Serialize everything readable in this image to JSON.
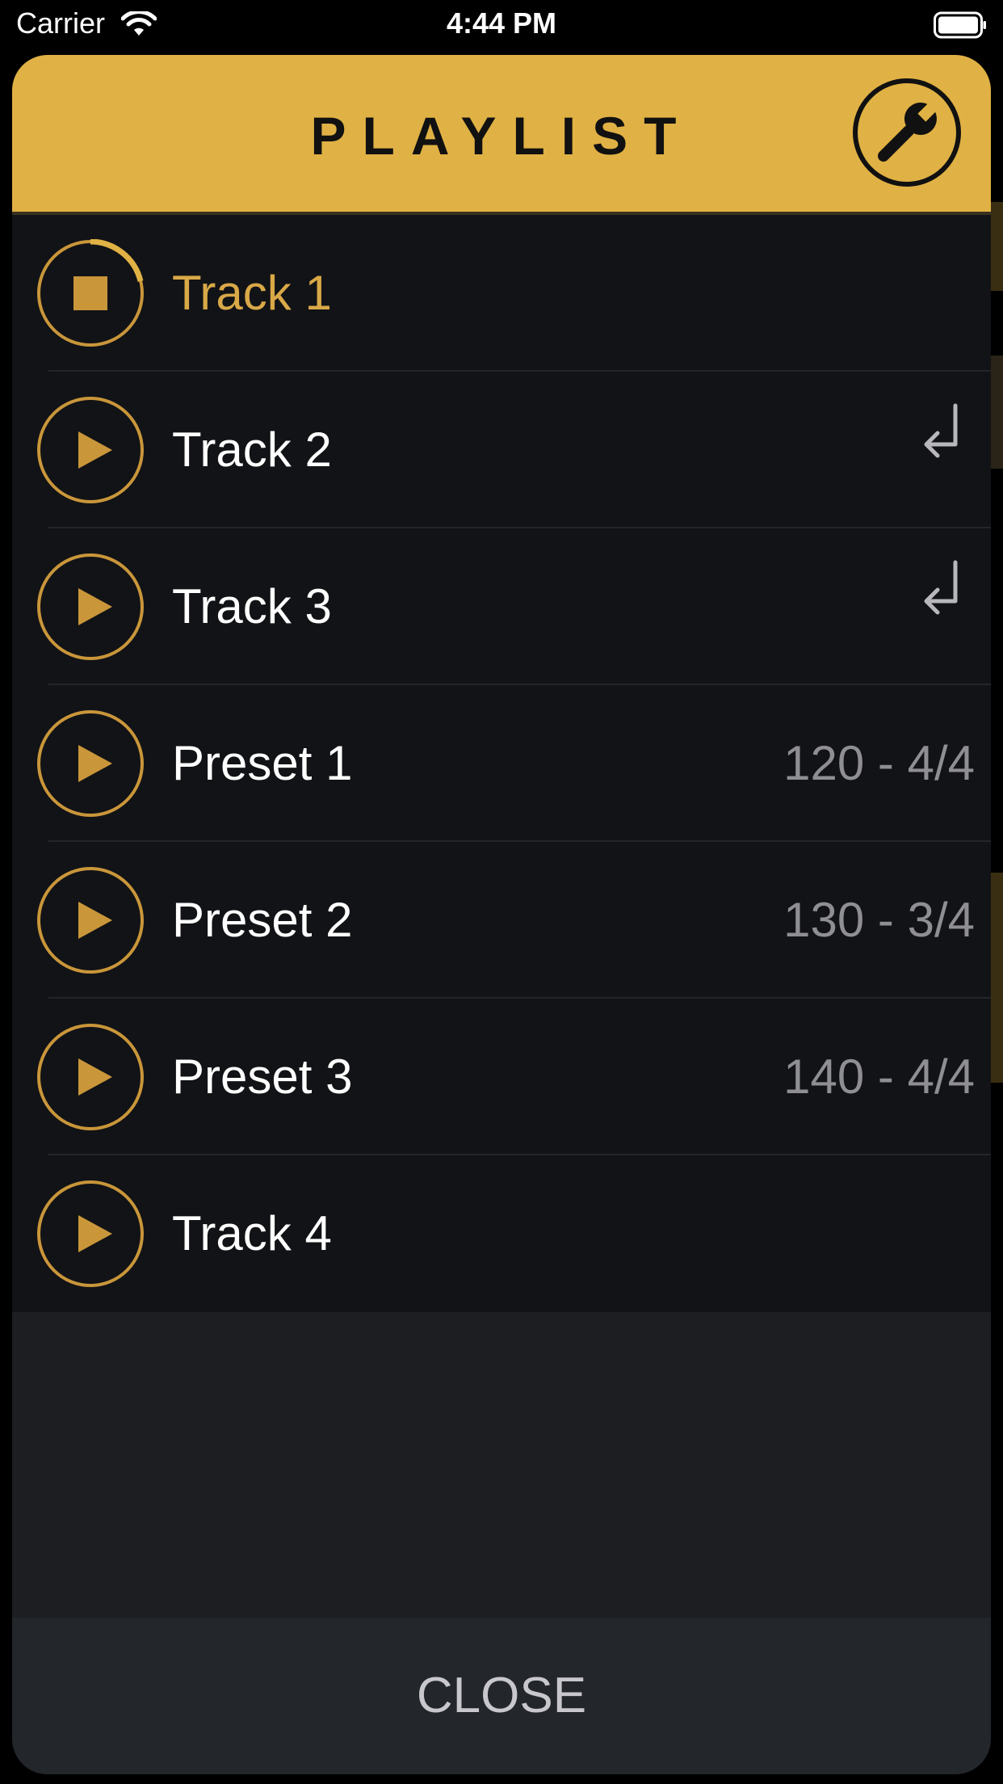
{
  "status_bar": {
    "carrier": "Carrier",
    "time": "4:44 PM",
    "wifi_icon": "wifi-icon",
    "battery_icon": "battery-full-icon"
  },
  "header": {
    "title": "PLAYLIST",
    "settings_icon": "wrench-icon"
  },
  "playlist": {
    "items": [
      {
        "title": "Track 1",
        "meta": "",
        "state": "playing",
        "icon": "stop-icon",
        "linked_to_next": true
      },
      {
        "title": "Track 2",
        "meta": "",
        "state": "idle",
        "icon": "play-icon",
        "linked_to_next": true
      },
      {
        "title": "Track 3",
        "meta": "",
        "state": "idle",
        "icon": "play-icon",
        "linked_to_next": false
      },
      {
        "title": "Preset 1",
        "meta": "120 - 4/4",
        "state": "idle",
        "icon": "play-icon",
        "linked_to_next": false
      },
      {
        "title": "Preset 2",
        "meta": "130 - 3/4",
        "state": "idle",
        "icon": "play-icon",
        "linked_to_next": false
      },
      {
        "title": "Preset 3",
        "meta": "140 - 4/4",
        "state": "idle",
        "icon": "play-icon",
        "linked_to_next": false
      },
      {
        "title": "Track 4",
        "meta": "",
        "state": "idle",
        "icon": "play-icon",
        "linked_to_next": false
      }
    ]
  },
  "footer": {
    "close_label": "CLOSE"
  },
  "colors": {
    "accent": "#e0b144",
    "accent_dark": "#c9963a",
    "list_background": "#121316",
    "sheet_background": "#1c1e22",
    "footer_background": "#23262b",
    "meta_text": "#8e8e93"
  }
}
